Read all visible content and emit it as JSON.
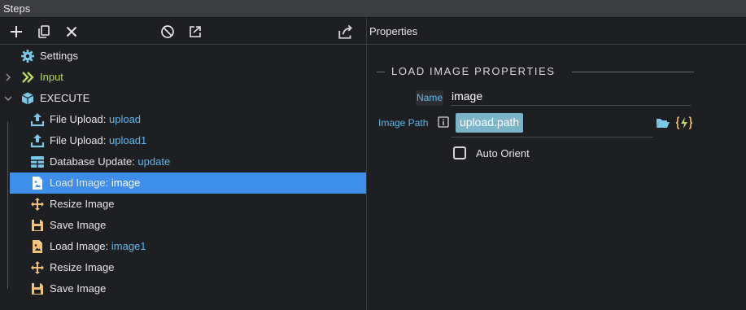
{
  "window": {
    "title": "Steps"
  },
  "toolbar": {
    "buttons": [
      {
        "name": "add-icon"
      },
      {
        "name": "copy-icon"
      },
      {
        "name": "close-icon"
      },
      {
        "name": "disable-icon"
      },
      {
        "name": "export-icon"
      }
    ]
  },
  "tree": {
    "items": [
      {
        "icon": "gear-icon",
        "label": "Settings",
        "value": ""
      },
      {
        "icon": "chevrons-icon",
        "label": "Input",
        "value": ""
      },
      {
        "icon": "box-icon",
        "label": "EXECUTE",
        "value": ""
      },
      {
        "icon": "upload-icon",
        "label": "File Upload: ",
        "value": "upload"
      },
      {
        "icon": "upload-icon",
        "label": "File Upload: ",
        "value": "upload1"
      },
      {
        "icon": "table-icon",
        "label": "Database Update: ",
        "value": "update"
      },
      {
        "icon": "image-file-icon",
        "label": "Load Image: ",
        "value": "image"
      },
      {
        "icon": "move-icon",
        "label": "Resize Image",
        "value": ""
      },
      {
        "icon": "save-icon",
        "label": "Save Image",
        "value": ""
      },
      {
        "icon": "image-file-icon",
        "label": "Load Image: ",
        "value": "image1"
      },
      {
        "icon": "move-icon",
        "label": "Resize Image",
        "value": ""
      },
      {
        "icon": "save-icon",
        "label": "Save Image",
        "value": ""
      }
    ],
    "selected_index": 6
  },
  "properties": {
    "header": "Properties",
    "section_title": "LOAD IMAGE PROPERTIES",
    "name_label": "Name",
    "name_value": "image",
    "path_label": "Image Path",
    "path_value": "upload.path",
    "auto_orient_label": "Auto Orient",
    "auto_orient_checked": false
  },
  "colors": {
    "selection": "#3e8eea",
    "accent_blue": "#5fb8ef",
    "input_green": "#b7d86a",
    "icon_orange": "#f2c27a",
    "icon_cyan": "#7cc7e8"
  }
}
